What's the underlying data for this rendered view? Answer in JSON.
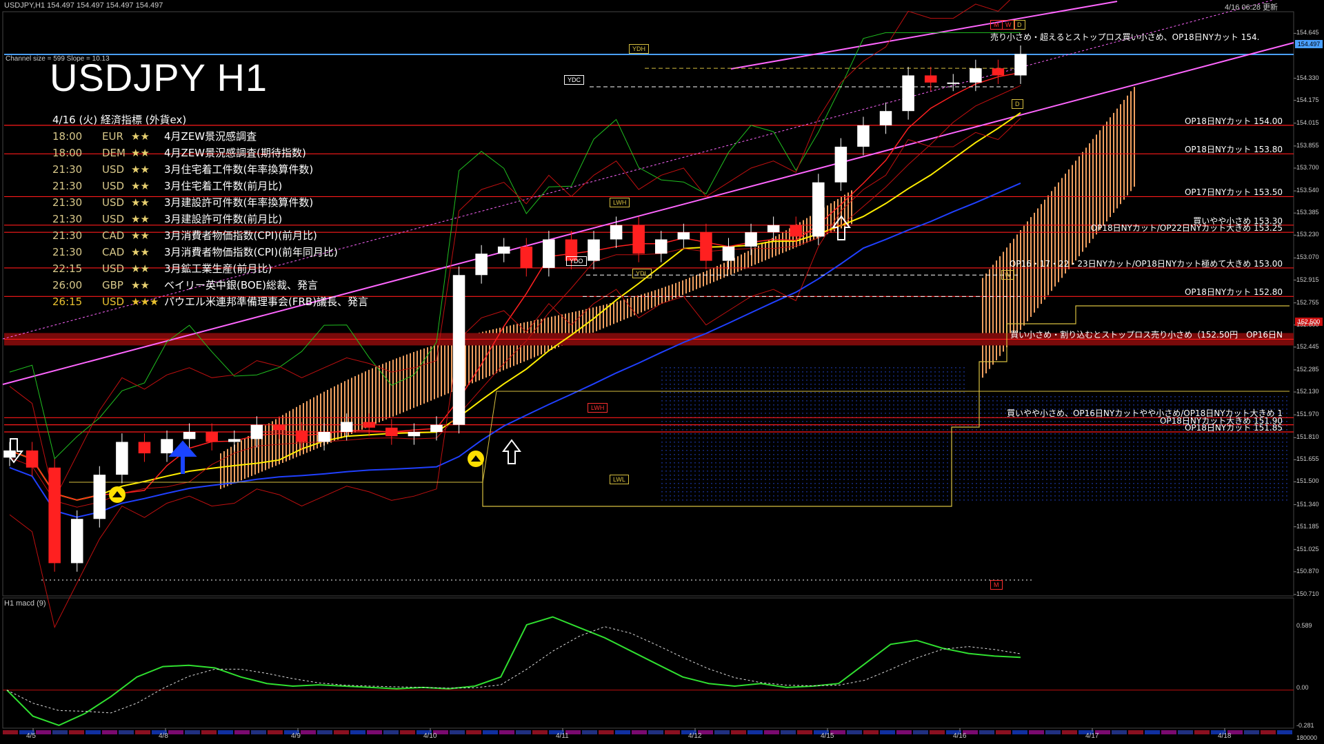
{
  "header": {
    "symbol_info": "USDJPY,H1  154.497 154.497 154.497 154.497",
    "updated": "4/16 06:28 更新"
  },
  "title": "USDJPY H1",
  "channel_info": "Channel size = 599 Slope = 10.13",
  "events": {
    "heading": "4/16 (火) 経済指標 (外貨ex)",
    "items": [
      {
        "time": "18:00",
        "cur": "EUR",
        "stars": "★★",
        "desc": "4月ZEW景況感調査",
        "highlight": false
      },
      {
        "time": "18:00",
        "cur": "DEM",
        "stars": "★★",
        "desc": "4月ZEW景況感調査(期待指数)",
        "highlight": false
      },
      {
        "time": "21:30",
        "cur": "USD",
        "stars": "★★",
        "desc": "3月住宅着工件数(年率換算件数)",
        "highlight": false
      },
      {
        "time": "21:30",
        "cur": "USD",
        "stars": "★★",
        "desc": "3月住宅着工件数(前月比)",
        "highlight": false
      },
      {
        "time": "21:30",
        "cur": "USD",
        "stars": "★★",
        "desc": "3月建設許可件数(年率換算件数)",
        "highlight": false
      },
      {
        "time": "21:30",
        "cur": "USD",
        "stars": "★★",
        "desc": "3月建設許可件数(前月比)",
        "highlight": false
      },
      {
        "time": "21:30",
        "cur": "CAD",
        "stars": "★★",
        "desc": "3月消費者物価指数(CPI)(前月比)",
        "highlight": false
      },
      {
        "time": "21:30",
        "cur": "CAD",
        "stars": "★★",
        "desc": "3月消費者物価指数(CPI)(前年同月比)",
        "highlight": false
      },
      {
        "time": "22:15",
        "cur": "USD",
        "stars": "★★",
        "desc": "3月鉱工業生産(前月比)",
        "highlight": false
      },
      {
        "time": "26:00",
        "cur": "GBP",
        "stars": "★★",
        "desc": "ベイリー英中銀(BOE)総裁、発言",
        "highlight": false
      },
      {
        "time": "26:15",
        "cur": "USD",
        "stars": "★★★",
        "desc": "パウエル米連邦準備理事会(FRB)議長、発言",
        "highlight": true
      }
    ]
  },
  "tags": {
    "ydh": "YDH",
    "ydc": "YDC",
    "ydo": "YDO",
    "ydl": "YDL",
    "lwh": "LWH",
    "lwl": "LWL",
    "mwd_m": "M",
    "mwd_w": "W",
    "mwd_d": "D",
    "d_marker": "D",
    "m_marker": "M",
    "w_marker": "W"
  },
  "macd_title": "H1  macd (9)",
  "macd_ylabels": [
    "0.589",
    "0.00",
    "-0.281"
  ],
  "macd_bottom_label": "180000",
  "chart_data": [
    {
      "type": "line",
      "title": "USDJPY H1",
      "price_axis": [
        "154.645",
        "154.330",
        "154.175",
        "154.015",
        "153.855",
        "153.700",
        "153.540",
        "153.385",
        "153.230",
        "153.070",
        "152.915",
        "152.755",
        "152.600",
        "152.445",
        "152.285",
        "152.130",
        "151.970",
        "151.810",
        "151.655",
        "151.500",
        "151.340",
        "151.185",
        "151.025",
        "150.870",
        "150.710"
      ],
      "ylim": [
        150.71,
        154.7
      ],
      "current_price": "154.497",
      "marked_price": "152.500",
      "x_labels": [
        "4/5",
        "4/8",
        "4/9",
        "4/10",
        "4/11",
        "4/12",
        "4/15",
        "4/16",
        "4/17",
        "4/18"
      ],
      "close_series": {
        "name": "USDJPY close",
        "values": [
          151.72,
          151.6,
          150.93,
          151.24,
          151.55,
          151.78,
          151.7,
          151.8,
          151.85,
          151.78,
          151.8,
          151.9,
          151.86,
          151.78,
          151.85,
          151.92,
          151.88,
          151.82,
          151.85,
          151.9,
          152.95,
          153.1,
          153.15,
          153.0,
          153.2,
          153.05,
          153.2,
          153.3,
          153.1,
          153.2,
          153.25,
          153.05,
          153.15,
          153.25,
          153.3,
          153.22,
          153.6,
          153.85,
          154.0,
          154.1,
          154.35,
          154.3,
          154.3,
          154.4,
          154.35,
          154.5
        ]
      },
      "horizontal_levels": [
        {
          "price": 154.0,
          "label": "OP18日NYカット 154.00"
        },
        {
          "price": 153.8,
          "label": "OP18日NYカット 153.80"
        },
        {
          "price": 153.5,
          "label": "OP17日NYカット 153.50"
        },
        {
          "price": 153.3,
          "label": "買いやや小さめ 153.30"
        },
        {
          "price": 153.25,
          "label": "OP18日NYカット/OP22日NYカット大きめ 153.25"
        },
        {
          "price": 153.0,
          "label": "OP16・17・22・23日NYカット/OP18日NYカット極めて大きめ 153.00"
        },
        {
          "price": 152.8,
          "label": "OP18日NYカット 152.80"
        },
        {
          "price": 152.5,
          "label": "買い小さめ・割り込むとストップロス売り小さめ（152.50円　OP16日N"
        },
        {
          "price": 151.95,
          "label": "買いやや小さめ、OP16日NYカットやや小さめ/OP18日NYカット大きめ 1"
        },
        {
          "price": 151.9,
          "label": "OP18日NYカット大きめ 151.90"
        },
        {
          "price": 151.85,
          "label": "OP18日NYカット 151.85"
        }
      ],
      "top_order_label": "売り小さめ・超えるとストップロス買い小さめ、OP18日NYカット 154.",
      "colors": {
        "candle_up": "#ffffff",
        "candle_down": "#ff2020",
        "ma_yellow": "#ffee00",
        "ma_blue": "#2040ff",
        "channel": "#ff66ff",
        "level": "#ff1a1a",
        "current": "#4aa0ff",
        "kumo": "#f0a060",
        "green_line": "#20c020"
      }
    },
    {
      "type": "line",
      "title": "H1  macd (9)",
      "x_labels": [
        "4/5",
        "4/8",
        "4/9",
        "4/10",
        "4/11",
        "4/12",
        "4/15",
        "4/16",
        "4/17",
        "4/18"
      ],
      "ylim": [
        -0.281,
        0.589
      ],
      "series": [
        {
          "name": "macd",
          "values": [
            0.0,
            -0.2,
            -0.27,
            -0.18,
            -0.05,
            0.1,
            0.18,
            0.19,
            0.17,
            0.1,
            0.05,
            0.03,
            0.04,
            0.03,
            0.02,
            0.01,
            0.02,
            0.01,
            0.03,
            0.1,
            0.5,
            0.56,
            0.48,
            0.4,
            0.3,
            0.2,
            0.1,
            0.05,
            0.03,
            0.05,
            0.02,
            0.03,
            0.05,
            0.2,
            0.35,
            0.38,
            0.32,
            0.28,
            0.26,
            0.25
          ]
        }
      ]
    }
  ]
}
